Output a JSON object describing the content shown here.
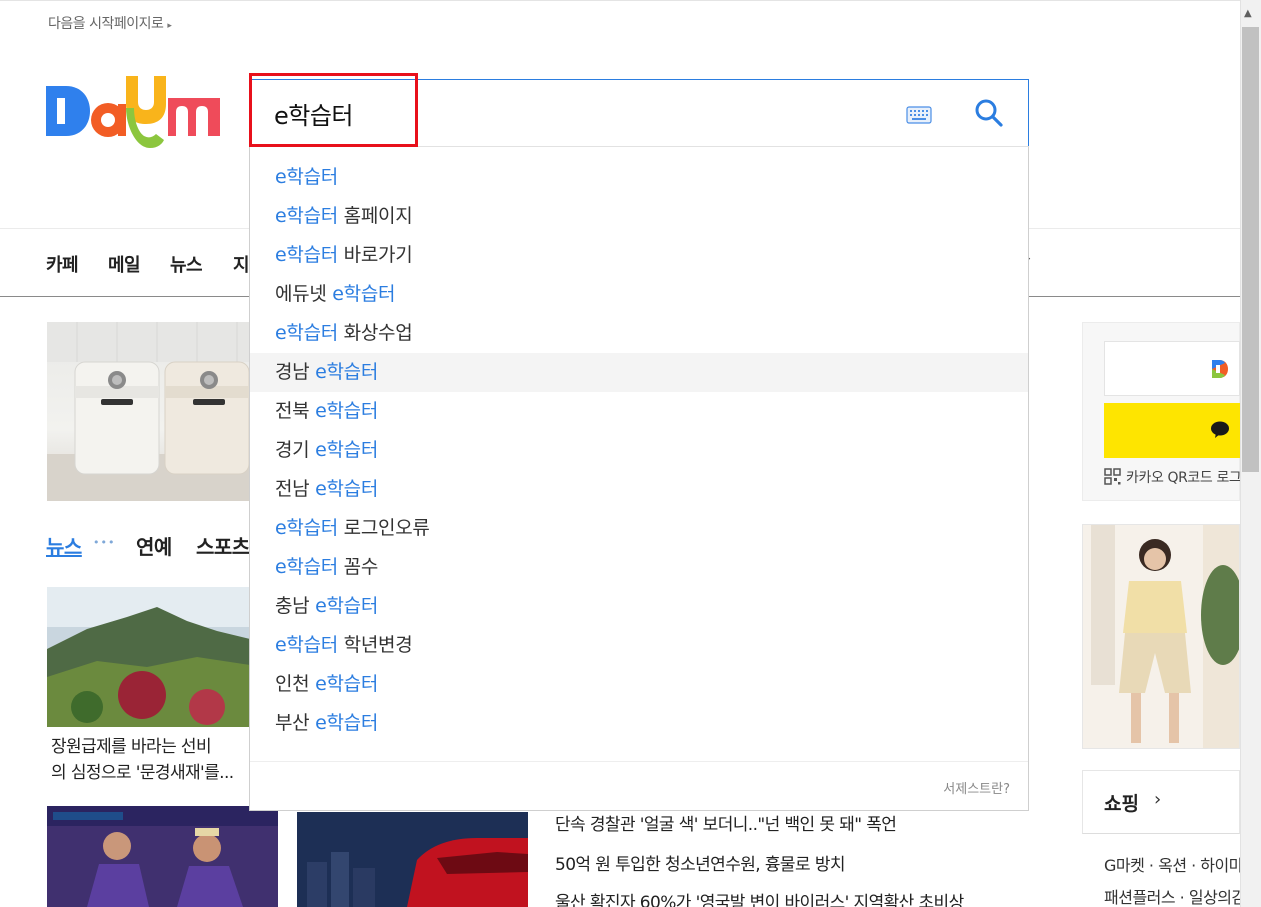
{
  "top": {
    "start_page_link": "다음을 시작페이지로"
  },
  "search": {
    "query": "e학습터"
  },
  "nav": {
    "items": [
      "카페",
      "메일",
      "뉴스",
      "지"
    ]
  },
  "suggestions": [
    {
      "pre": "",
      "hl": "e학습터",
      "post": ""
    },
    {
      "pre": "",
      "hl": "e학습터",
      "post": " 홈페이지"
    },
    {
      "pre": "",
      "hl": "e학습터",
      "post": " 바로가기"
    },
    {
      "pre": "에듀넷 ",
      "hl": "e학습터",
      "post": ""
    },
    {
      "pre": "",
      "hl": "e학습터",
      "post": " 화상수업"
    },
    {
      "pre": "경남 ",
      "hl": "e학습터",
      "post": ""
    },
    {
      "pre": "전북 ",
      "hl": "e학습터",
      "post": ""
    },
    {
      "pre": "경기 ",
      "hl": "e학습터",
      "post": ""
    },
    {
      "pre": "전남 ",
      "hl": "e학습터",
      "post": ""
    },
    {
      "pre": "",
      "hl": "e학습터",
      "post": " 로그인오류"
    },
    {
      "pre": "",
      "hl": "e학습터",
      "post": " 꼼수"
    },
    {
      "pre": "충남 ",
      "hl": "e학습터",
      "post": ""
    },
    {
      "pre": "",
      "hl": "e학습터",
      "post": " 학년변경"
    },
    {
      "pre": "인천 ",
      "hl": "e학습터",
      "post": ""
    },
    {
      "pre": "부산 ",
      "hl": "e학습터",
      "post": ""
    }
  ],
  "suggest_footer": {
    "help": "서제스트란?"
  },
  "news_tabs": {
    "news": "뉴스",
    "dots": "•••",
    "entertainment": "연예",
    "sports": "스포츠"
  },
  "news_cards": {
    "caption1_line1": "장원급제를 바라는 선비",
    "caption1_line2": "의 심정으로 '문경새재'를..."
  },
  "headlines": [
    "단속 경찰관 '얼굴 색' 보더니..\"넌 백인 못 돼\" 폭언",
    "50억 원 투입한 청소년연수원, 흉물로 방치",
    "울산 확진자 60%가 '영국발 변이 바이러스' 지역확산 초비상"
  ],
  "login": {
    "qr_text": "카카오 QR코드 로그인"
  },
  "shopping": {
    "title": "쇼핑",
    "line1": "G마켓 · 옥션 · 하이마트",
    "line2": "패션플러스 · 일상의감각"
  },
  "colors": {
    "accent": "#2b7de0",
    "highlight_box": "#e8101b",
    "kakao": "#fee500"
  }
}
